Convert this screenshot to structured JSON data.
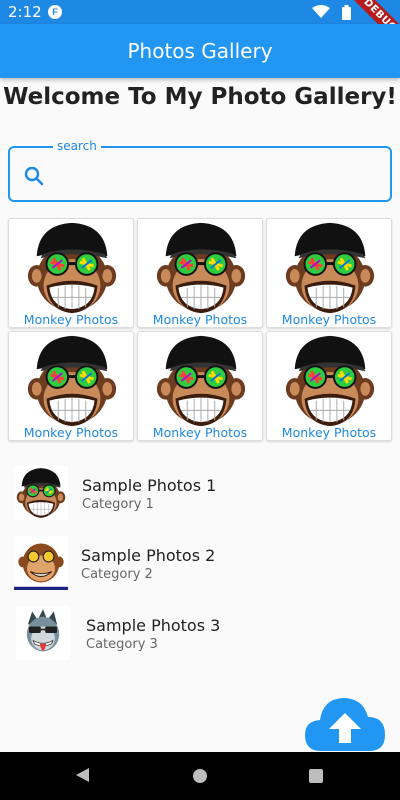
{
  "status_bar": {
    "time": "2:12",
    "debug_label": "DEBUG"
  },
  "app_bar": {
    "title": "Photos Gallery"
  },
  "welcome_text": "Welcome To My Photo Gallery!",
  "search": {
    "label": "search",
    "value": "",
    "placeholder": ""
  },
  "grid": {
    "items": [
      {
        "label": "Monkey Photos",
        "icon": "monkey-icon"
      },
      {
        "label": "Monkey Photos",
        "icon": "monkey-icon"
      },
      {
        "label": "Monkey Photos",
        "icon": "monkey-icon"
      },
      {
        "label": "Monkey Photos",
        "icon": "monkey-icon"
      },
      {
        "label": "Monkey Photos",
        "icon": "monkey-icon"
      },
      {
        "label": "Monkey Photos",
        "icon": "monkey-icon"
      }
    ]
  },
  "list": {
    "items": [
      {
        "title": "Sample Photos 1",
        "subtitle": "Category 1",
        "icon": "monkey-cap-icon"
      },
      {
        "title": "Sample Photos 2",
        "subtitle": "Category 2",
        "icon": "monkey-glasses-icon"
      },
      {
        "title": "Sample Photos 3",
        "subtitle": "Category 3",
        "icon": "monkey-tongue-icon"
      }
    ]
  },
  "fab": {
    "icon": "cloud-upload-icon"
  },
  "colors": {
    "primary": "#2196f3",
    "status_bar": "#1e88e5",
    "debug": "#b71c1c"
  }
}
